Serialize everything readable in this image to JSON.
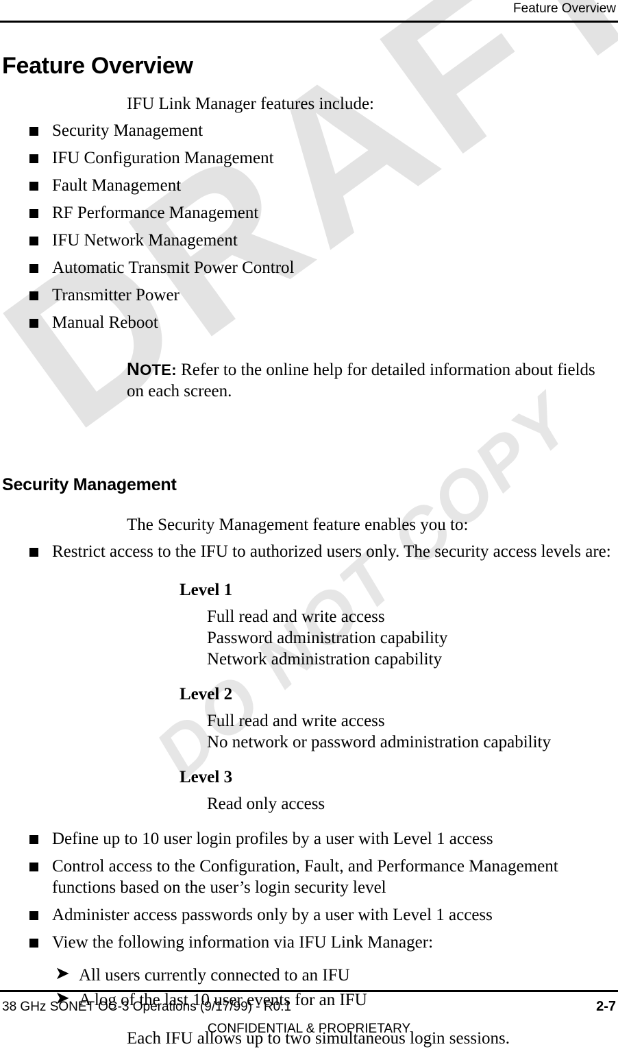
{
  "header": {
    "running_head": "Feature Overview"
  },
  "watermarks": {
    "primary": "DRAFT",
    "secondary": "DO NOT COPY",
    "color": "#e3e3e3"
  },
  "chapter": {
    "title": "Feature Overview",
    "intro": "IFU Link Manager features include:",
    "features": [
      "Security Management",
      "IFU Configuration Management",
      "Fault Management",
      "RF Performance Management",
      "IFU Network Management",
      "Automatic Transmit Power Control",
      "Transmitter Power",
      "Manual Reboot"
    ],
    "note": {
      "label_cap": "N",
      "label_rest": "OTE:",
      "text": "Refer to the online help for detailed information about fields on each screen."
    }
  },
  "security_section": {
    "title": "Security Management",
    "intro": "The Security Management feature enables you to:",
    "first_bullet": "Restrict access to the IFU to authorized users only. The security access levels are:",
    "levels": [
      {
        "name": "Level 1",
        "lines": [
          "Full read and write access",
          "Password administration capability",
          "Network administration capability"
        ]
      },
      {
        "name": "Level 2",
        "lines": [
          "Full read and write access",
          "No network or password administration capability"
        ]
      },
      {
        "name": "Level 3",
        "lines": [
          "Read only access"
        ]
      }
    ],
    "bullets": [
      "Define up to 10 user login profiles by a user with Level 1 access",
      "Control access to the Configuration, Fault, and Performance Management functions based on the user’s login security level",
      "Administer access passwords only by a user with Level 1 access",
      "View the following information via IFU Link Manager:"
    ],
    "sub_bullets": [
      "All users currently connected to an IFU",
      "A log of the last 10 user events for an IFU"
    ],
    "closing": "Each IFU allows up to two simultaneous login sessions."
  },
  "footer": {
    "document": "38 GHz SONET OC-3 Operations  (9/17/99) - R0.1",
    "page_number": "2-7",
    "confidentiality": "CONFIDENTIAL & PROPRIETARY"
  },
  "icons": {
    "square_bullet": "square-bullet-icon",
    "arrow_bullet": "arrow-bullet-icon"
  }
}
